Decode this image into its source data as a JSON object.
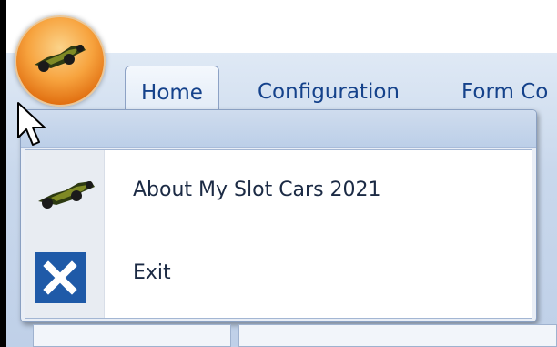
{
  "app": {
    "orb_icon": "slot-car-icon"
  },
  "ribbon": {
    "tabs": [
      {
        "label": "Home",
        "active": true
      },
      {
        "label": "Configuration",
        "active": false
      },
      {
        "label": "Form Co",
        "active": false
      }
    ]
  },
  "menu": {
    "items": [
      {
        "label": "About My Slot Cars 2021",
        "icon": "slot-car-icon"
      },
      {
        "label": "Exit",
        "icon": "close-icon"
      }
    ]
  },
  "colors": {
    "accent_orb": "#f7a33e",
    "exit_icon_bg": "#1f5aa8",
    "tab_text": "#15428b"
  }
}
